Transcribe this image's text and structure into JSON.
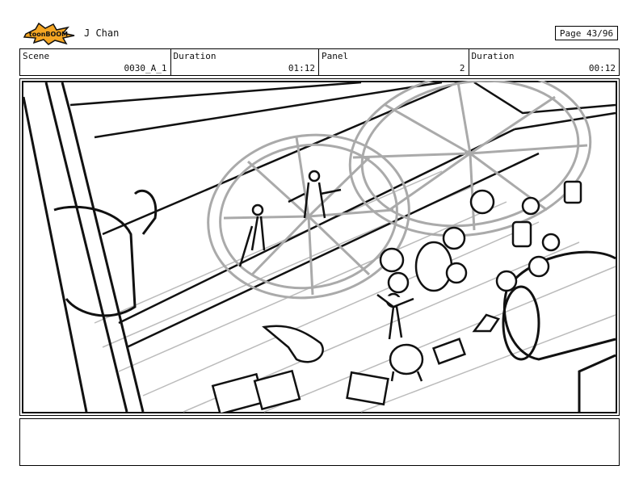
{
  "header": {
    "logo_text": "toonBOOM",
    "author": "J Chan",
    "page_label": "Page 43/96"
  },
  "info": {
    "scene_label": "Scene",
    "scene_value": "0030_A_1",
    "duration1_label": "Duration",
    "duration1_value": "01:12",
    "panel_label": "Panel",
    "panel_value": "2",
    "duration2_label": "Duration",
    "duration2_value": "00:12"
  },
  "colors": {
    "logo_burst": "#f5a623",
    "logo_outline": "#111111",
    "sketch_line": "#111111",
    "wheel_line": "#aaaaaa"
  }
}
